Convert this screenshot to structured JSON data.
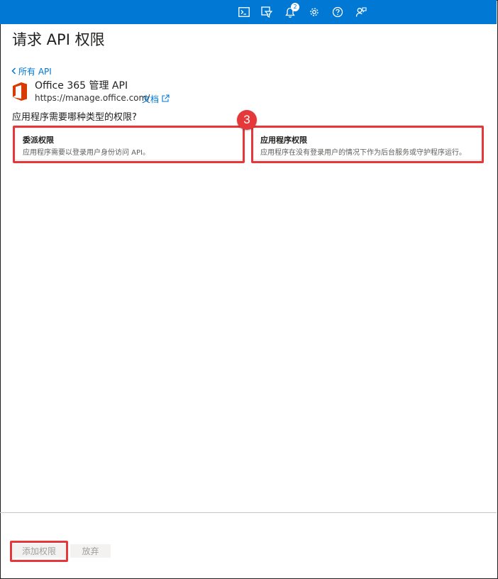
{
  "topbar": {
    "notification_count": "2",
    "icons": [
      "cloud-shell-icon",
      "directory-filter-icon",
      "notifications-icon",
      "settings-icon",
      "help-icon",
      "feedback-icon"
    ]
  },
  "page": {
    "title": "请求 API 权限",
    "back_label": "所有 API",
    "api": {
      "name": "Office 365 管理 API",
      "url": "https://manage.office.com/",
      "docs_label": "文档"
    },
    "question": "应用程序需要哪种类型的权限?"
  },
  "cards": [
    {
      "title": "委派权限",
      "description": "应用程序需要以登录用户身份访问 API。"
    },
    {
      "title": "应用程序权限",
      "description": "应用程序在没有登录用户的情况下作为后台服务或守护程序运行。"
    }
  ],
  "annotation": {
    "step": "3"
  },
  "footer": {
    "add_label": "添加权限",
    "discard_label": "放弃"
  },
  "colors": {
    "accent": "#0078d4",
    "highlight": "#e5383b",
    "office_orange": "#d83b01"
  }
}
